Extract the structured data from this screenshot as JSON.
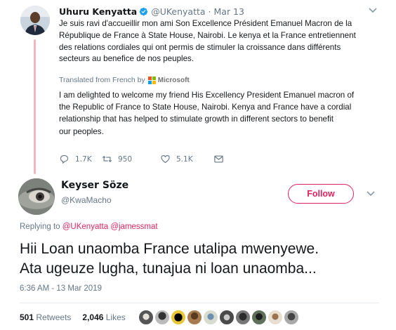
{
  "original_tweet": {
    "display_name": "Uhuru Kenyatta",
    "handle": "@UKenyatta",
    "separator": "·",
    "date": "Mar 13",
    "text": "Je suis ravi d'accueillir mon ami Son Excellence Président Emanuel Macron de la\nRépublique de France à State House, Nairobi. Le kenya et la France entretiennent\ndes relations cordiales qui ont permis de stimuler la croissance dans différents\nsecteurs au benefice de nos peuples.",
    "translated_from": "Translated from French by",
    "translator": "Microsoft",
    "translation": "I am delighted to welcome my friend His Excellency President Emanuel macron of\nthe Republic of France to State House, Nairobi. Kenya and France have a cordial\nrelationship that has helped to stimulate growth in different sectors to benefit\nour peoples.",
    "actions": {
      "replies": "1.7K",
      "retweets": "950",
      "likes": "5.1K"
    }
  },
  "main_tweet": {
    "display_name": "Keyser Söze",
    "handle": "@KwaMacho",
    "follow_label": "Follow",
    "replying_to_label": "Replying to",
    "replying_to_handles": "@UKenyatta @jamessmat",
    "text": "Hii Loan unaomba France utalipa mwenyewe.\nAta ugeuze lugha, tunajua ni loan unaomba...",
    "timestamp": "6:36 AM - 13 Mar 2019",
    "retweet_count": "501",
    "retweet_label": "Retweets",
    "like_count": "2,046",
    "like_label": "Likes"
  },
  "colors": {
    "accent": "#e0245e",
    "secondary_text": "#657786",
    "thread_line": "#f0b7c0",
    "verified": "#1da1f2"
  },
  "icons": [
    "verified-badge-icon",
    "chevron-down-icon",
    "reply-icon",
    "retweet-icon",
    "like-icon",
    "direct-message-icon",
    "microsoft-logo"
  ]
}
